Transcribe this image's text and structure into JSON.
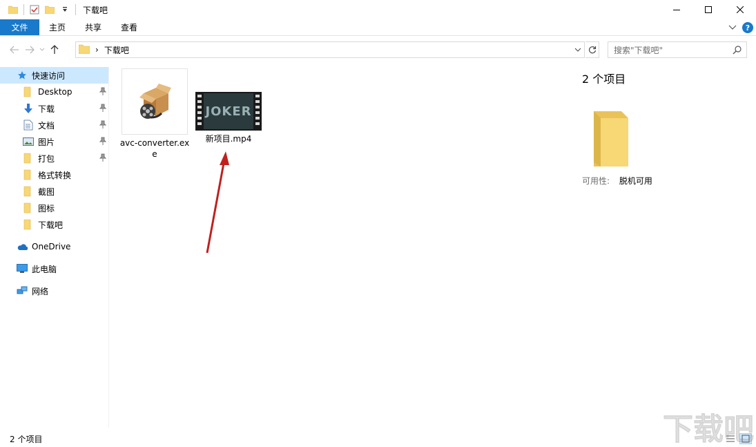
{
  "window": {
    "title": "下载吧",
    "controls": {
      "minimize": "—",
      "maximize": "☐",
      "close": "✕"
    }
  },
  "ribbon": {
    "tabs": [
      "文件",
      "主页",
      "共享",
      "查看"
    ],
    "help": "?"
  },
  "address": {
    "path": "下载吧",
    "separator": "›"
  },
  "search": {
    "placeholder": "搜索\"下载吧\""
  },
  "sidebar": {
    "quick_access": "快速访问",
    "items": [
      {
        "label": "Desktop",
        "icon": "folder-icon",
        "pinned": true
      },
      {
        "label": "下载",
        "icon": "download-arrow-icon",
        "pinned": true
      },
      {
        "label": "文档",
        "icon": "document-icon",
        "pinned": true
      },
      {
        "label": "图片",
        "icon": "picture-icon",
        "pinned": true
      },
      {
        "label": "打包",
        "icon": "folder-icon",
        "pinned": true
      },
      {
        "label": "格式转换",
        "icon": "folder-icon",
        "pinned": false
      },
      {
        "label": "截图",
        "icon": "folder-icon",
        "pinned": false
      },
      {
        "label": "图标",
        "icon": "folder-icon",
        "pinned": false
      },
      {
        "label": "下载吧",
        "icon": "folder-icon",
        "pinned": false
      }
    ],
    "onedrive": "OneDrive",
    "this_pc": "此电脑",
    "network": "网络"
  },
  "files": [
    {
      "name": "avc-converter.exe",
      "icon": "installer-box-icon"
    },
    {
      "name": "新项目.mp4",
      "icon": "video-thumbnail-icon",
      "thumb_text": "JOKER"
    }
  ],
  "details": {
    "count": "2 个项目",
    "availability_label": "可用性:",
    "availability_value": "脱机可用"
  },
  "status": {
    "count": "2 个项目"
  },
  "watermark": {
    "text": "下载吧"
  },
  "colors": {
    "accent": "#1979ca",
    "selection": "#cce8ff",
    "folder": "#f8d775",
    "arrow": "#c0201e"
  }
}
